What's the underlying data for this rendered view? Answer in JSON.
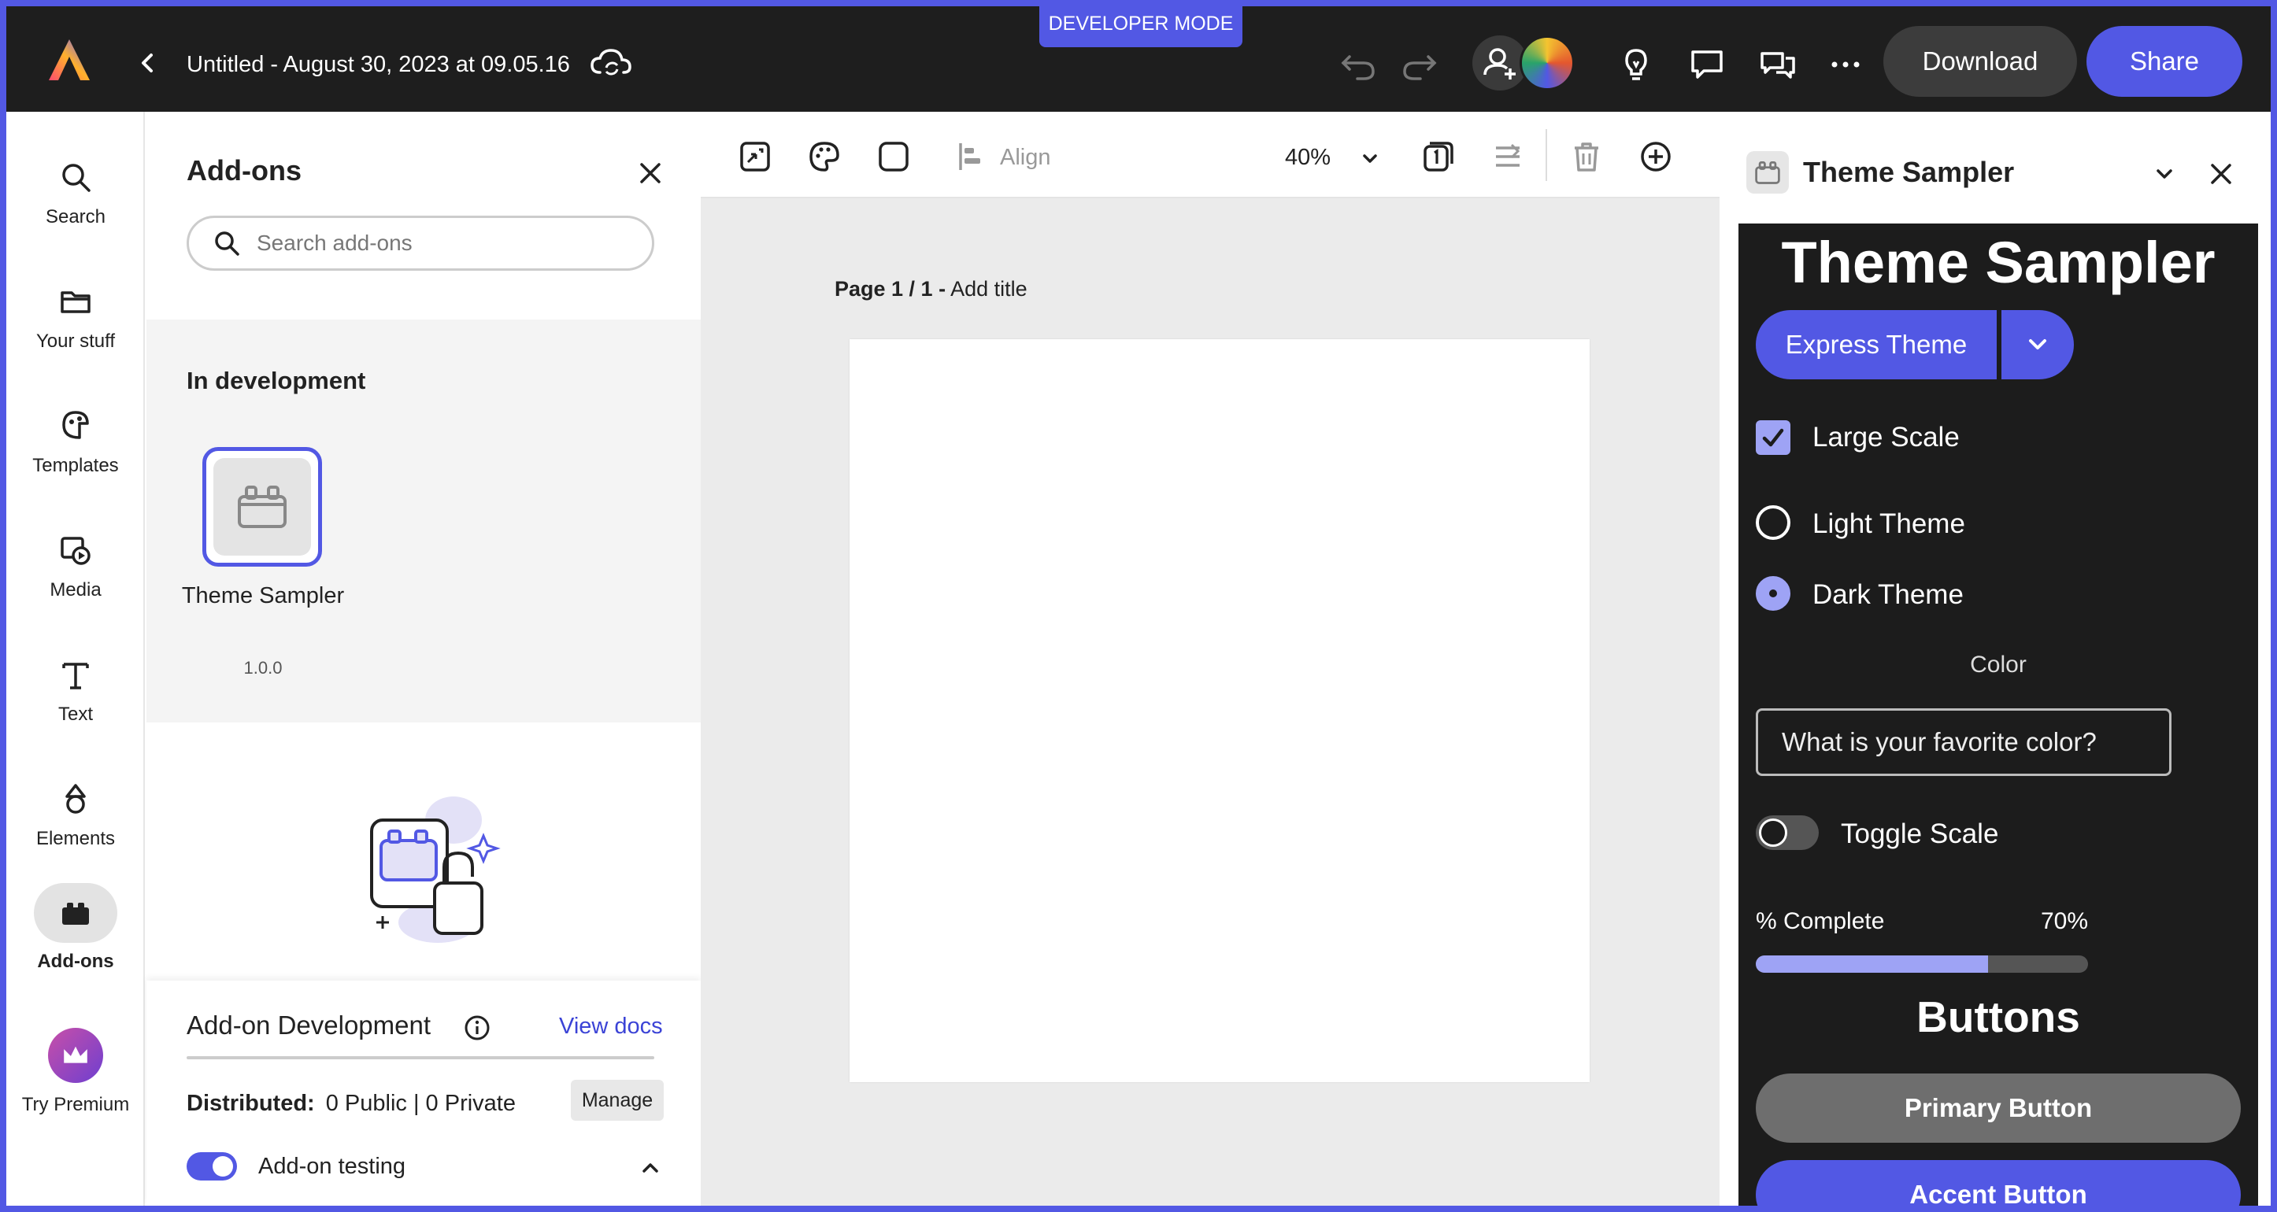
{
  "dev_mode_badge": "DEVELOPER MODE",
  "header": {
    "doc_title": "Untitled - August 30, 2023 at 09.05.16",
    "download_label": "Download",
    "share_label": "Share"
  },
  "rail": {
    "items": [
      {
        "label": "Search",
        "icon": "search-icon"
      },
      {
        "label": "Your stuff",
        "icon": "folder-icon"
      },
      {
        "label": "Templates",
        "icon": "templates-icon"
      },
      {
        "label": "Media",
        "icon": "media-icon"
      },
      {
        "label": "Text",
        "icon": "text-icon"
      },
      {
        "label": "Elements",
        "icon": "elements-icon"
      },
      {
        "label": "Add-ons",
        "icon": "addons-icon",
        "active": true
      },
      {
        "label": "Try Premium",
        "icon": "crown-icon"
      }
    ]
  },
  "addons_panel": {
    "title": "Add-ons",
    "search_placeholder": "Search add-ons",
    "in_development_title": "In development",
    "addon": {
      "name": "Theme Sampler",
      "version": "1.0.0"
    },
    "dev_section": {
      "title": "Add-on Development",
      "view_docs": "View docs",
      "distributed_label": "Distributed:",
      "distributed_value": "0 Public | 0 Private",
      "manage_label": "Manage",
      "testing_label": "Add-on testing"
    }
  },
  "canvas": {
    "align_label": "Align",
    "zoom": "40%",
    "page_label": "Page 1 / 1 -",
    "page_title_placeholder": "Add title"
  },
  "theme_sampler": {
    "panel_title": "Theme Sampler",
    "heading": "Theme Sampler",
    "theme_select": "Express Theme",
    "large_scale_label": "Large Scale",
    "light_theme_label": "Light Theme",
    "dark_theme_label": "Dark Theme",
    "color_label": "Color",
    "color_placeholder": "What is your favorite color?",
    "toggle_scale_label": "Toggle Scale",
    "progress_label": "% Complete",
    "progress_value_text": "70%",
    "progress_value": 0.7,
    "buttons_heading": "Buttons",
    "primary_button": "Primary Button",
    "accent_button": "Accent Button"
  },
  "colors": {
    "accent": "#5258e4",
    "topbar": "#1e1e1e",
    "sampler_bg": "#1c1c1c",
    "sampler_accent_light": "#9ea3f5"
  }
}
